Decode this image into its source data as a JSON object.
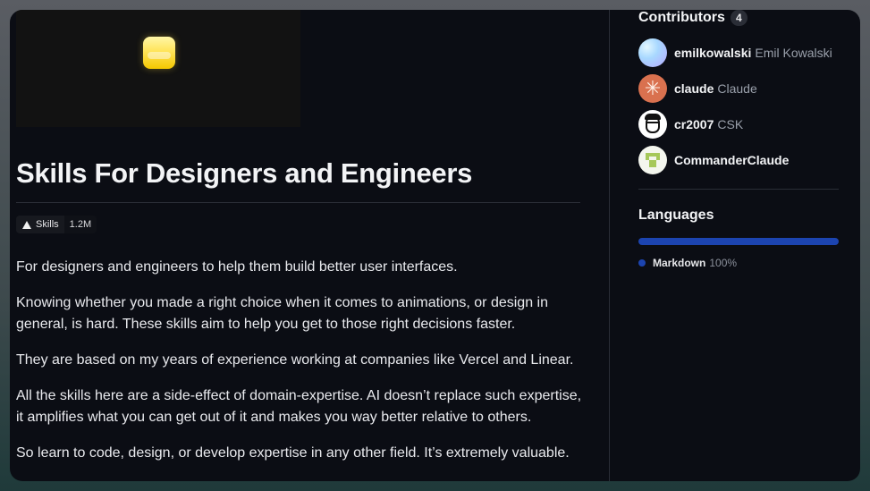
{
  "repo": {
    "title": "Skills For Designers and Engineers",
    "badge": {
      "icon": "triangle-icon",
      "label": "Skills",
      "count": "1.2M"
    },
    "readme": [
      "For designers and engineers to help them build better user interfaces.",
      "Knowing whether you made a right choice when it comes to animations, or design in general, is hard. These skills aim to help you get to those right decisions faster.",
      "They are based on my years of experience working at companies like Vercel and Linear.",
      "All the skills here are a side-effect of domain-expertise. AI doesn’t replace such expertise, it amplifies what you can get out of it and makes you way better relative to others.",
      "So learn to code, design, or develop expertise in any other field. It’s extremely valuable."
    ]
  },
  "sidebar": {
    "contributors": {
      "title": "Contributors",
      "count": "4",
      "items": [
        {
          "login": "emilkowalski",
          "name": "Emil Kowalski"
        },
        {
          "login": "claude",
          "name": "Claude"
        },
        {
          "login": "cr2007",
          "name": "CSK"
        },
        {
          "login": "CommanderClaude",
          "name": ""
        }
      ]
    },
    "languages": {
      "title": "Languages",
      "items": [
        {
          "name": "Markdown",
          "percent": "100%",
          "color": "#1c44b0"
        }
      ]
    }
  }
}
